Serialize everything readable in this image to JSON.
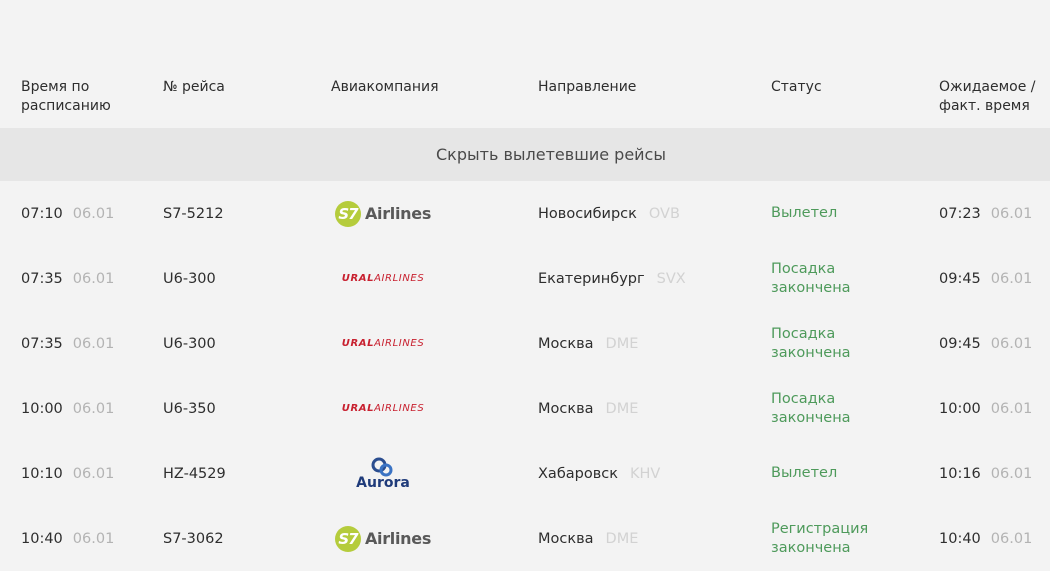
{
  "columns": {
    "time": "Время по расписанию",
    "flight": "№ рейса",
    "airline": "Авиакомпания",
    "direction": "Направление",
    "status": "Статус",
    "expected": "Ожидаемое / факт. время"
  },
  "toggle_label": "Скрыть вылетевшие рейсы",
  "flights": [
    {
      "time": "07:10",
      "date": "06.01",
      "flight": "S7-5212",
      "airline": "S7 Airlines",
      "logo": "s7",
      "city": "Новосибирск",
      "code": "OVB",
      "status": "Вылетел",
      "exp_time": "07:23",
      "exp_date": "06.01"
    },
    {
      "time": "07:35",
      "date": "06.01",
      "flight": "U6-300",
      "airline": "Ural Airlines",
      "logo": "ural",
      "city": "Екатеринбург",
      "code": "SVX",
      "status": "Посадка закончена",
      "exp_time": "09:45",
      "exp_date": "06.01"
    },
    {
      "time": "07:35",
      "date": "06.01",
      "flight": "U6-300",
      "airline": "Ural Airlines",
      "logo": "ural",
      "city": "Москва",
      "code": "DME",
      "status": "Посадка закончена",
      "exp_time": "09:45",
      "exp_date": "06.01"
    },
    {
      "time": "10:00",
      "date": "06.01",
      "flight": "U6-350",
      "airline": "Ural Airlines",
      "logo": "ural",
      "city": "Москва",
      "code": "DME",
      "status": "Посадка закончена",
      "exp_time": "10:00",
      "exp_date": "06.01"
    },
    {
      "time": "10:10",
      "date": "06.01",
      "flight": "HZ-4529",
      "airline": "Aurora",
      "logo": "aurora",
      "city": "Хабаровск",
      "code": "KHV",
      "status": "Вылетел",
      "exp_time": "10:16",
      "exp_date": "06.01"
    },
    {
      "time": "10:40",
      "date": "06.01",
      "flight": "S7-3062",
      "airline": "S7 Airlines",
      "logo": "s7",
      "city": "Москва",
      "code": "DME",
      "status": "Регистрация закончена",
      "exp_time": "10:40",
      "exp_date": "06.01"
    }
  ],
  "logos": {
    "s7": {
      "mark": "S7",
      "word": "Airlines",
      "color": "#b5cc3c"
    },
    "ural": {
      "part1": "URAL",
      "part2": "AIRLINES",
      "color": "#c8202f"
    },
    "aurora": {
      "word": "Aurora",
      "color": "#1f3b7a"
    }
  },
  "colors": {
    "status": "#4e9a5b",
    "muted": "#b3b3b3",
    "toggle_bg": "#e6e6e6",
    "background": "#f3f3f3"
  }
}
